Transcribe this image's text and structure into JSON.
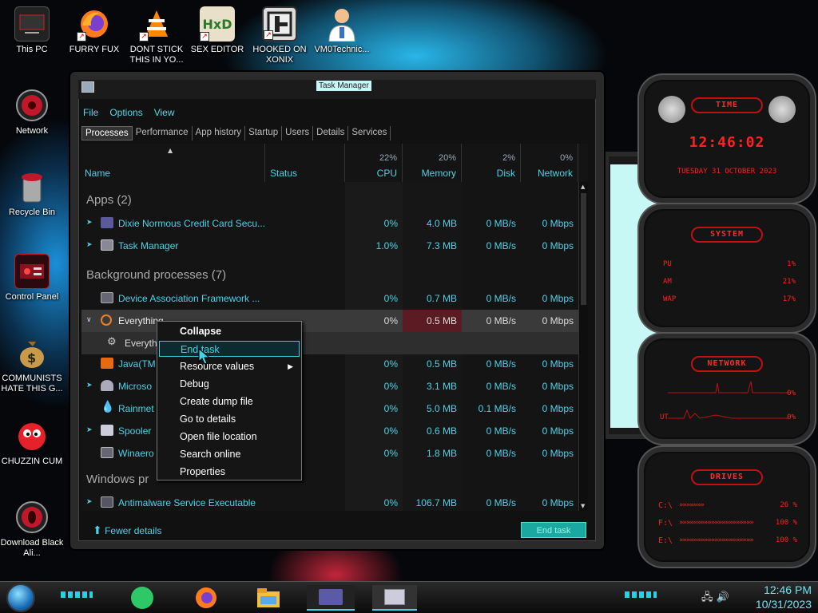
{
  "desktop": {
    "icons": [
      {
        "label": "This PC",
        "icon": "computer-icon"
      },
      {
        "label": "FURRY FUX",
        "icon": "firefox-icon"
      },
      {
        "label": "DONT STICK THIS IN YO...",
        "icon": "vlc-icon"
      },
      {
        "label": "SEX EDITOR",
        "icon": "hxd-icon"
      },
      {
        "label": "HOOKED ON XONIX",
        "icon": "xonix-icon"
      },
      {
        "label": "VM0Technic...",
        "icon": "doctor-icon"
      },
      {
        "label": "Network",
        "icon": "network-icon"
      },
      {
        "label": "Recycle Bin",
        "icon": "recycle-bin-icon"
      },
      {
        "label": "Control Panel",
        "icon": "control-panel-icon"
      },
      {
        "label": "COMMUNISTS HATE THIS G...",
        "icon": "money-bag-icon"
      },
      {
        "label": "CHUZZIN CUM",
        "icon": "chuzzle-icon"
      },
      {
        "label": "Download Black Ali...",
        "icon": "alienware-icon"
      }
    ]
  },
  "gadgets": {
    "time": {
      "title": "TIME",
      "time": "12:46:02",
      "date": "TUESDAY 31 OCTOBER 2023"
    },
    "system": {
      "title": "SYSTEM",
      "rows": [
        {
          "label": "PU",
          "value": "1%"
        },
        {
          "label": "AM",
          "value": "21%"
        },
        {
          "label": "WAP",
          "value": "17%"
        }
      ]
    },
    "network": {
      "title": "NETWORK",
      "rows": [
        {
          "label": "",
          "value": "0%"
        },
        {
          "label": "UT",
          "value": "0%"
        }
      ]
    },
    "drives": {
      "title": "DRIVES",
      "rows": [
        {
          "label": "C:\\",
          "value": "26 %"
        },
        {
          "label": "F:\\",
          "value": "100 %"
        },
        {
          "label": "E:\\",
          "value": "100 %"
        }
      ]
    }
  },
  "window": {
    "title": "Task Manager",
    "menu": [
      "File",
      "Options",
      "View"
    ],
    "tabs": [
      "Processes",
      "Performance",
      "App history",
      "Startup",
      "Users",
      "Details",
      "Services"
    ],
    "columns": {
      "name": "Name",
      "status": "Status",
      "cpu": {
        "pct": "22%",
        "label": "CPU"
      },
      "memory": {
        "pct": "20%",
        "label": "Memory"
      },
      "disk": {
        "pct": "2%",
        "label": "Disk"
      },
      "network": {
        "pct": "0%",
        "label": "Network"
      }
    },
    "groups": {
      "apps": "Apps (2)",
      "background": "Background processes (7)",
      "windows": "Windows pr"
    },
    "rows": [
      {
        "name": "Dixie Normous Credit Card Secu...",
        "cpu": "0%",
        "mem": "4.0 MB",
        "disk": "0 MB/s",
        "net": "0 Mbps"
      },
      {
        "name": "Task Manager",
        "cpu": "1.0%",
        "mem": "7.3 MB",
        "disk": "0 MB/s",
        "net": "0 Mbps"
      },
      {
        "name": "Device Association Framework ...",
        "cpu": "0%",
        "mem": "0.7 MB",
        "disk": "0 MB/s",
        "net": "0 Mbps"
      },
      {
        "name": "Everything",
        "cpu": "0%",
        "mem": "0.5 MB",
        "disk": "0 MB/s",
        "net": "0 Mbps"
      },
      {
        "name": "Everyth",
        "cpu": "",
        "mem": "",
        "disk": "",
        "net": ""
      },
      {
        "name": "Java(TM",
        "cpu": "0%",
        "mem": "0.5 MB",
        "disk": "0 MB/s",
        "net": "0 Mbps"
      },
      {
        "name": "Microso",
        "cpu": "0%",
        "mem": "3.1 MB",
        "disk": "0 MB/s",
        "net": "0 Mbps"
      },
      {
        "name": "Rainmet",
        "cpu": "0%",
        "mem": "5.0 MB",
        "disk": "0.1 MB/s",
        "net": "0 Mbps"
      },
      {
        "name": "Spooler",
        "cpu": "0%",
        "mem": "0.6 MB",
        "disk": "0 MB/s",
        "net": "0 Mbps"
      },
      {
        "name": "Winaero",
        "cpu": "0%",
        "mem": "1.8 MB",
        "disk": "0 MB/s",
        "net": "0 Mbps"
      },
      {
        "name": "Antimalware Service Executable",
        "cpu": "0%",
        "mem": "106.7 MB",
        "disk": "0 MB/s",
        "net": "0 Mbps"
      }
    ],
    "fewer_details": "Fewer details",
    "end_task": "End task"
  },
  "context_menu": [
    "Collapse",
    "End task",
    "Resource values",
    "Debug",
    "Create dump file",
    "Go to details",
    "Open file location",
    "Search online",
    "Properties"
  ],
  "taskbar": {
    "time": "12:46 PM",
    "date": "10/31/2023"
  },
  "colors": {
    "accent": "#4bd2e8",
    "gadget_red": "#ff2020",
    "highlight_mem": "#5a1c22"
  }
}
